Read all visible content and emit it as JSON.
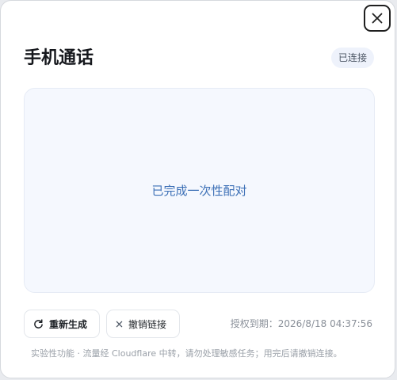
{
  "dialog": {
    "title": "手机通话",
    "status_badge": "已连接",
    "close_icon": "close-icon"
  },
  "pairing": {
    "message": "已完成一次性配对"
  },
  "actions": {
    "regenerate_label": "重新生成",
    "regenerate_icon": "refresh-icon",
    "revoke_label": "撤销链接",
    "revoke_icon": "x-icon"
  },
  "expiry": {
    "text": "授权到期：2026/8/18 04:37:56"
  },
  "footnote": {
    "text": "实验性功能 · 流量经 Cloudflare 中转，请勿处理敏感任务；用完后请撤销连接。"
  },
  "colors": {
    "accent_text": "#3b6fb6",
    "panel_bg": "#f5f8fe",
    "badge_bg": "#eef2fb"
  }
}
